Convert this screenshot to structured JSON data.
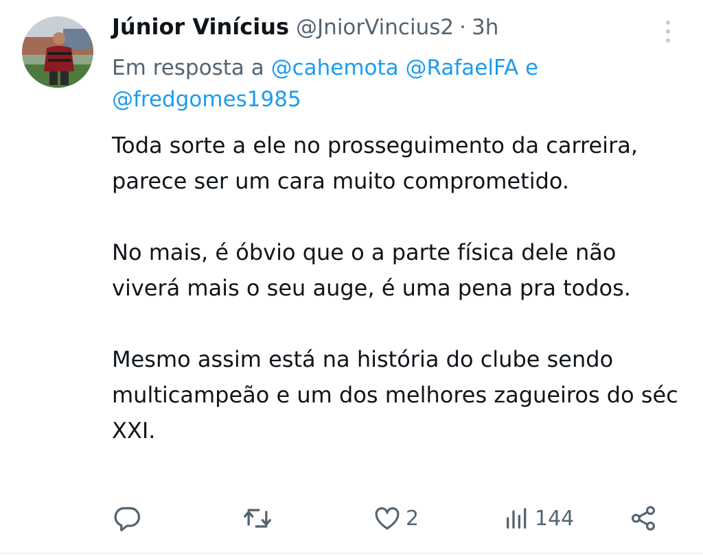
{
  "tweet": {
    "author_name": "Júnior Vinícius",
    "author_handle": "@JniorVincius2",
    "separator": "·",
    "time": "3h",
    "reply_prefix": "Em resposta a",
    "mentions": [
      "@cahemota",
      "@RafaelFA",
      "@fredgomes1985"
    ],
    "mention_joiner": "e",
    "paragraphs": [
      "Toda sorte a ele no prosseguimento da carreira, parece ser um cara muito comprometido.",
      "No mais, é óbvio que o a parte física dele não viverá mais o seu auge, é uma pena pra todos.",
      "Mesmo assim está na história do clube sendo multicampeão e um dos melhores zagueiros do séc XXI."
    ]
  },
  "actions": {
    "reply": {
      "icon": "reply-icon",
      "count": ""
    },
    "retweet": {
      "icon": "retweet-icon",
      "count": ""
    },
    "like": {
      "icon": "heart-icon",
      "count": "2"
    },
    "views": {
      "icon": "views-icon",
      "count": "144"
    },
    "share": {
      "icon": "share-icon",
      "count": ""
    }
  },
  "colors": {
    "text": "#0f1419",
    "secondary": "#536471",
    "accent": "#1d9bf0"
  }
}
